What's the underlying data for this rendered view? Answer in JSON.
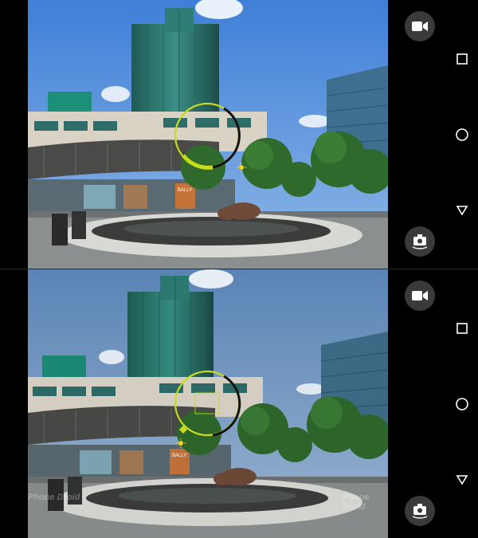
{
  "screens": [
    {
      "id": "top",
      "controls": {
        "video_icon": "video-camera-icon",
        "switch_icon": "switch-camera-icon"
      },
      "focus_ring": {
        "color": "#c8dc1e",
        "exposure_icon": "sun-icon"
      },
      "signs": {
        "bally": "BALLY"
      }
    },
    {
      "id": "bottom",
      "controls": {
        "video_icon": "video-camera-icon",
        "switch_icon": "switch-camera-icon"
      },
      "focus_ring": {
        "color": "#c8dc1e",
        "exposure_icon": "sun-icon"
      },
      "signs": {
        "bally": "BALLY"
      },
      "watermark": {
        "left": "Phone Droid",
        "right": "Phone Droid"
      }
    }
  ],
  "navbar": {
    "recents_icon": "square-recents-icon",
    "home_icon": "circle-home-icon",
    "back_icon": "triangle-back-icon"
  },
  "colors": {
    "accent": "#c8dc1e",
    "control_bg": "#3a3a3a",
    "sky": "#5f8fc8"
  }
}
